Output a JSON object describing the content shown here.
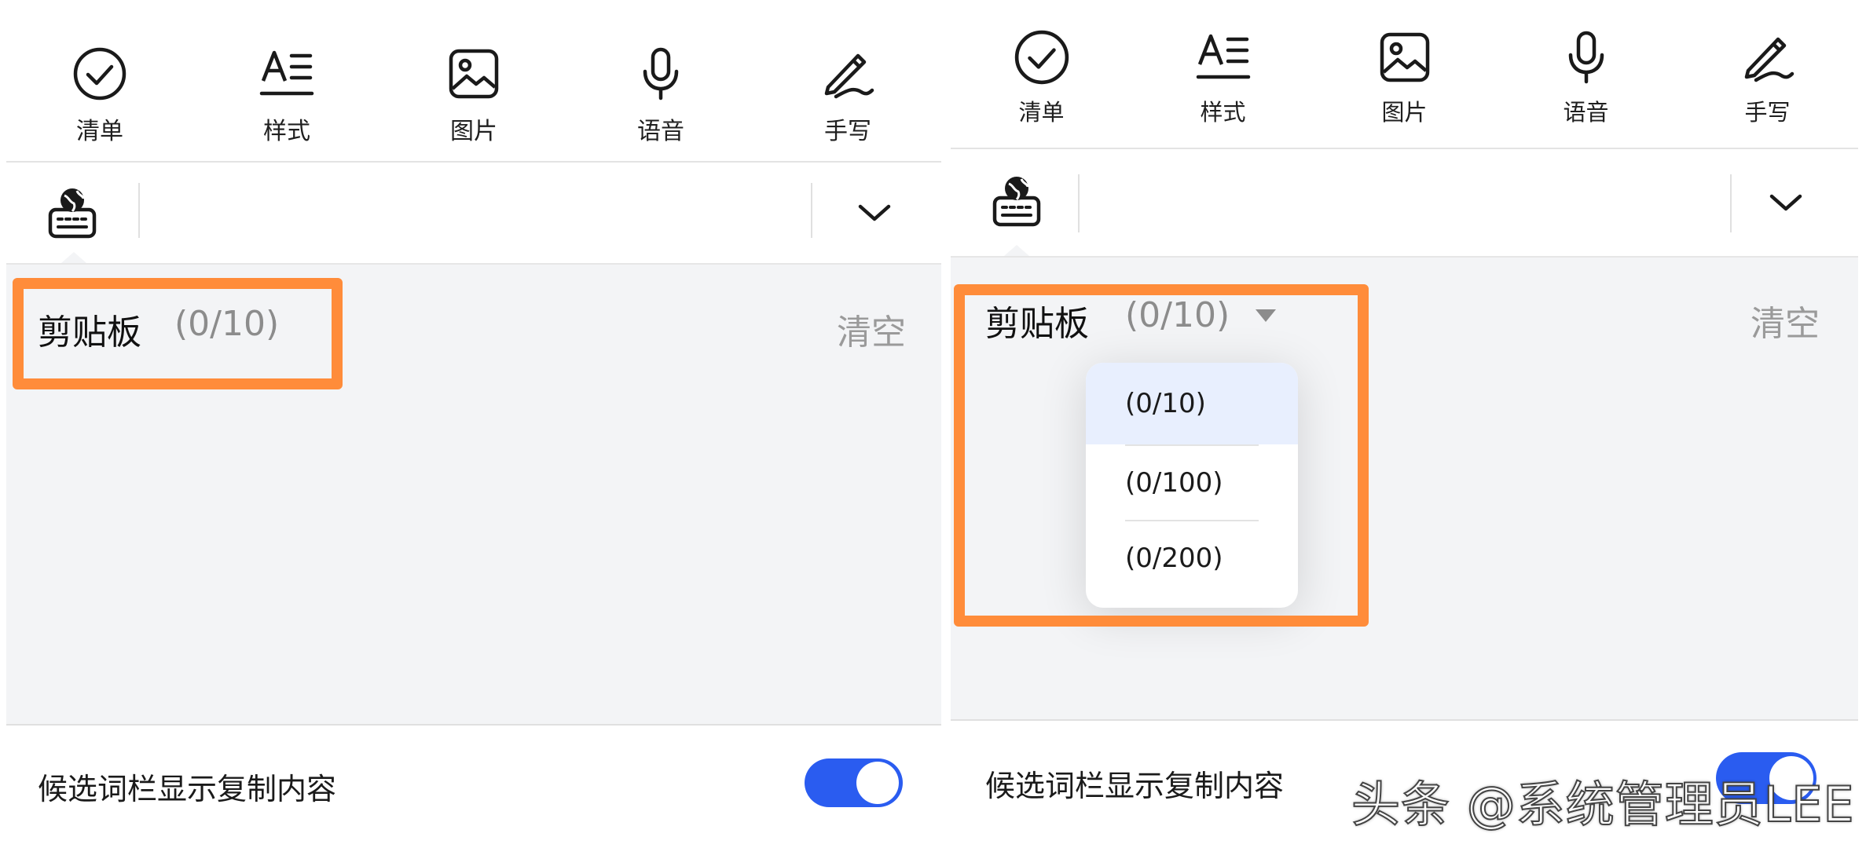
{
  "toolbar": {
    "items": [
      {
        "label": "清单",
        "icon": "checklist-icon"
      },
      {
        "label": "样式",
        "icon": "text-style-icon"
      },
      {
        "label": "图片",
        "icon": "image-icon"
      },
      {
        "label": "语音",
        "icon": "microphone-icon"
      },
      {
        "label": "手写",
        "icon": "handwriting-pen-icon"
      }
    ]
  },
  "keyboard_bar": {
    "switch_icon": "globe-keyboard-icon",
    "collapse_icon": "chevron-down-icon"
  },
  "clipboard": {
    "title": "剪贴板",
    "count": "(0/10)",
    "clear": "清空",
    "options": [
      "(0/10)",
      "(0/100)",
      "(0/200)"
    ],
    "selected_option": "(0/10)"
  },
  "setting": {
    "label": "候选词栏显示复制内容",
    "toggle_on": true
  },
  "watermark": "头条 @系统管理员LEE",
  "colors": {
    "accent_blue": "#2a5cf0",
    "highlight_orange": "#ff8c3a",
    "panel_bg": "#f3f4f6",
    "selected_bg": "#e8effe"
  }
}
